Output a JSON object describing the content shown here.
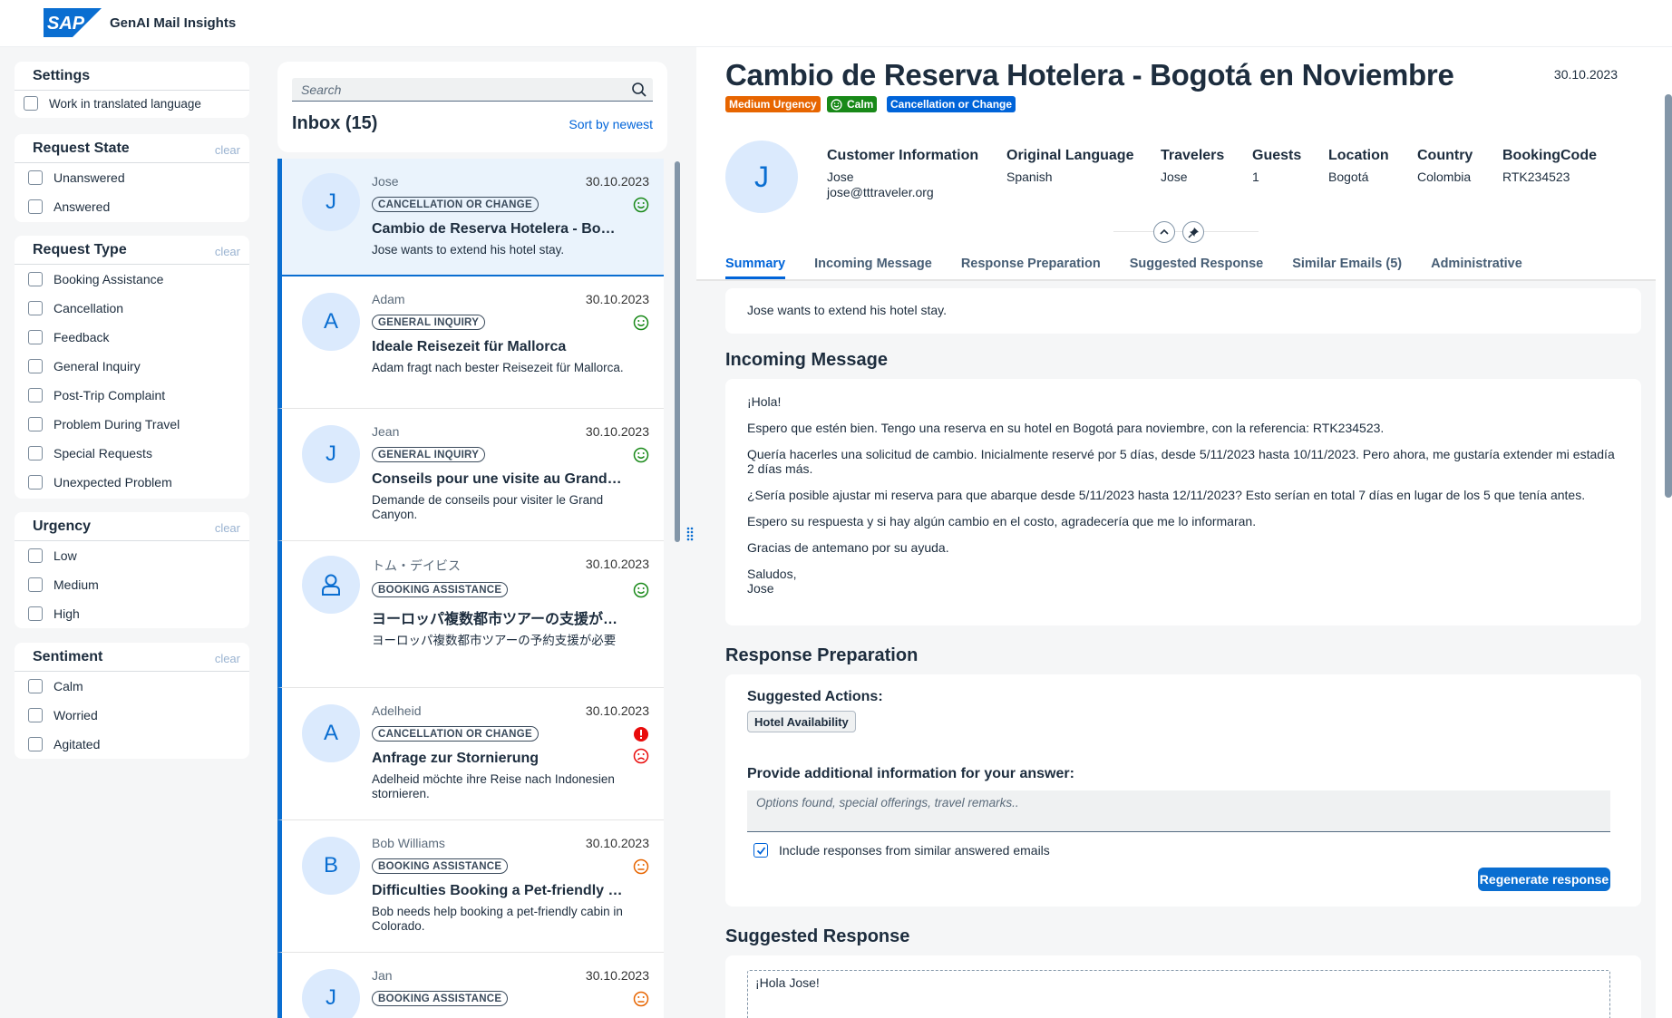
{
  "app": {
    "title": "GenAI Mail Insights",
    "logo_text": "SAP"
  },
  "settings": {
    "title": "Settings",
    "option": "Work in translated language"
  },
  "filters": {
    "clear_label": "clear",
    "request_state": {
      "title": "Request State",
      "options": [
        "Unanswered",
        "Answered"
      ]
    },
    "request_type": {
      "title": "Request Type",
      "options": [
        "Booking Assistance",
        "Cancellation",
        "Feedback",
        "General Inquiry",
        "Post-Trip Complaint",
        "Problem During Travel",
        "Special Requests",
        "Unexpected Problem"
      ]
    },
    "urgency": {
      "title": "Urgency",
      "options": [
        "Low",
        "Medium",
        "High"
      ]
    },
    "sentiment": {
      "title": "Sentiment",
      "options": [
        "Calm",
        "Worried",
        "Agitated"
      ]
    }
  },
  "inbox": {
    "search_placeholder": "Search",
    "title": "Inbox (15)",
    "sort_label": "Sort by newest",
    "items": [
      {
        "initial": "J",
        "name": "Jose",
        "date": "30.10.2023",
        "badge": "CANCELLATION OR CHANGE",
        "subject": "Cambio de Reserva Hotelera - Bogotá en Noviembre",
        "summary": "Jose wants to extend his hotel stay."
      },
      {
        "initial": "A",
        "name": "Adam",
        "date": "30.10.2023",
        "badge": "GENERAL INQUIRY",
        "subject": "Ideale Reisezeit für Mallorca",
        "summary": "Adam fragt nach bester Reisezeit für Mallorca."
      },
      {
        "initial": "J",
        "name": "Jean",
        "date": "30.10.2023",
        "badge": "GENERAL INQUIRY",
        "subject": "Conseils pour une visite au Grand Canyon",
        "summary": "Demande de conseils pour visiter le Grand Canyon."
      },
      {
        "initial": "",
        "name": "トム・デイビス",
        "date": "30.10.2023",
        "badge": "BOOKING ASSISTANCE",
        "subject": "ヨーロッパ複数都市ツアーの支援が必要",
        "summary": "ヨーロッパ複数都市ツアーの予約支援が必要"
      },
      {
        "initial": "A",
        "name": "Adelheid",
        "date": "30.10.2023",
        "badge": "CANCELLATION OR CHANGE",
        "subject": "Anfrage zur Stornierung",
        "summary": "Adelheid möchte ihre Reise nach Indonesien stornieren."
      },
      {
        "initial": "B",
        "name": "Bob Williams",
        "date": "30.10.2023",
        "badge": "BOOKING ASSISTANCE",
        "subject": "Difficulties Booking a Pet-friendly Cabin",
        "summary": "Bob needs help booking a pet-friendly cabin in Colorado."
      },
      {
        "initial": "J",
        "name": "Jan",
        "date": "30.10.2023",
        "badge": "BOOKING ASSISTANCE",
        "subject": "",
        "summary": ""
      }
    ]
  },
  "detail": {
    "title": "Cambio de Reserva Hotelera - Bogotá en Noviembre",
    "date": "30.10.2023",
    "tags": [
      "Medium Urgency",
      "Calm",
      "Cancellation or Change"
    ],
    "avatar": "J",
    "info": [
      {
        "label": "Customer Information",
        "value": "Jose",
        "value2": "jose@tttraveler.org"
      },
      {
        "label": "Original Language",
        "value": "Spanish"
      },
      {
        "label": "Travelers",
        "value": "Jose"
      },
      {
        "label": "Guests",
        "value": "1"
      },
      {
        "label": "Location",
        "value": "Bogotá"
      },
      {
        "label": "Country",
        "value": "Colombia"
      },
      {
        "label": "BookingCode",
        "value": "RTK234523"
      }
    ],
    "tabs": [
      "Summary",
      "Incoming Message",
      "Response Preparation",
      "Suggested Response",
      "Similar Emails (5)",
      "Administrative"
    ],
    "summary": "Jose wants to extend his hotel stay.",
    "incoming_title": "Incoming Message",
    "message": [
      "¡Hola!",
      "Espero que estén bien. Tengo una reserva en su hotel en Bogotá para noviembre, con la referencia: RTK234523.",
      "Quería hacerles una solicitud de cambio. Inicialmente reservé por 5 días, desde 5/11/2023 hasta 10/11/2023. Pero ahora, me gustaría extender mi estadía 2 días más.",
      "¿Sería posible ajustar mi reserva para que abarque desde 5/11/2023 hasta 12/11/2023? Esto serían en total 7 días en lugar de los 5 que tenía antes.",
      "Espero su respuesta y si hay algún cambio en el costo, agradecería que me lo informaran.",
      "Gracias de antemano por su ayuda.",
      "Saludos,",
      "Jose"
    ],
    "prep_title": "Response Preparation",
    "suggested_actions_label": "Suggested Actions:",
    "action_chip": "Hotel Availability",
    "additional_label": "Provide additional information for your answer:",
    "additional_placeholder": "Options found, special offerings, travel remarks..",
    "include_label": "Include responses from similar answered emails",
    "regenerate_label": "Regenerate response",
    "suggested_title": "Suggested Response",
    "suggested_first_line": "¡Hola Jose!"
  },
  "colors": {
    "accent": "#0a6ed1",
    "urgency_tag": "#e76500",
    "calm_tag": "#188918",
    "type_tag": "#0064d9",
    "negative": "#e90b0b",
    "warning": "#e76500",
    "positive": "#188918"
  }
}
